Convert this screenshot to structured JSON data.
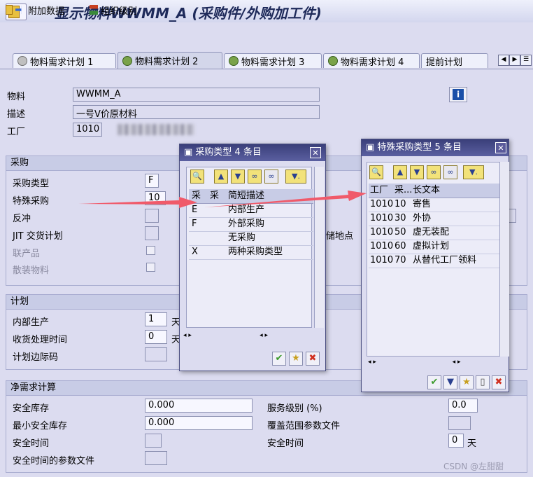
{
  "window": {
    "title": "显示物料WWMM_A (采购件/外购加工件)"
  },
  "toolbar": {
    "additional_data": "附加数据",
    "org_levels": "组织级别"
  },
  "tabs": [
    {
      "label": "物料需求计划 1"
    },
    {
      "label": "物料需求计划 2"
    },
    {
      "label": "物料需求计划 3"
    },
    {
      "label": "物料需求计划 4"
    },
    {
      "label": "提前计划"
    }
  ],
  "header": {
    "material_label": "物料",
    "material_value": "WWMM_A",
    "desc_label": "描述",
    "desc_value": "一号V价原材料",
    "plant_label": "工厂",
    "plant_value": "1010"
  },
  "procurement": {
    "title": "采购",
    "proc_type_label": "采购类型",
    "proc_type_value": "F",
    "special_proc_label": "特殊采购",
    "special_proc_value": "10",
    "backflush_label": "反冲",
    "jit_label": "JIT 交货计划",
    "coproduct_label": "联产品",
    "bulk_label": "散装物料",
    "storage_loc_label": "储地点"
  },
  "scheduling": {
    "title": "计划",
    "inhouse_label": "内部生产",
    "inhouse_value": "1",
    "inhouse_unit": "天",
    "gr_label": "收货处理时间",
    "gr_value": "0",
    "gr_unit": "天",
    "margin_label": "计划边际码"
  },
  "net_req": {
    "title": "净需求计算",
    "safety_stock_label": "安全库存",
    "safety_stock_value": "0.000",
    "min_safety_label": "最小安全库存",
    "min_safety_value": "0.000",
    "safety_time_label": "安全时间",
    "safety_profile_label": "安全时间的参数文件",
    "service_level_label": "服务级别 (%)",
    "service_level_value": "0.0",
    "coverage_label": "覆盖范围参数文件",
    "safety_time2_label": "安全时间",
    "safety_time2_value": "0",
    "safety_time2_unit": "天"
  },
  "popup_proc": {
    "title": "采购类型 4 条目",
    "col1": "采",
    "col2": "采",
    "col3": "简短描述",
    "rows": [
      {
        "code": "E",
        "desc": "内部生产"
      },
      {
        "code": "F",
        "desc": "外部采购"
      },
      {
        "code": "",
        "desc": "无采购"
      },
      {
        "code": "X",
        "desc": "两种采购类型"
      }
    ]
  },
  "popup_special": {
    "title": "特殊采购类型 5 条目",
    "col1": "工厂",
    "col2": "采...",
    "col3": "长文本",
    "rows": [
      {
        "plant": "1010",
        "code": "10",
        "text": "寄售"
      },
      {
        "plant": "1010",
        "code": "30",
        "text": "外协"
      },
      {
        "plant": "1010",
        "code": "50",
        "text": "虚无装配"
      },
      {
        "plant": "1010",
        "code": "60",
        "text": "虚拟计划"
      },
      {
        "plant": "1010",
        "code": "70",
        "text": "从替代工厂领料"
      }
    ]
  },
  "watermark": "CSDN @左甜甜",
  "colors": {
    "popup_title": "#3a3f7a",
    "arrow": "#f05a6a",
    "background": "#dcdcf0"
  }
}
